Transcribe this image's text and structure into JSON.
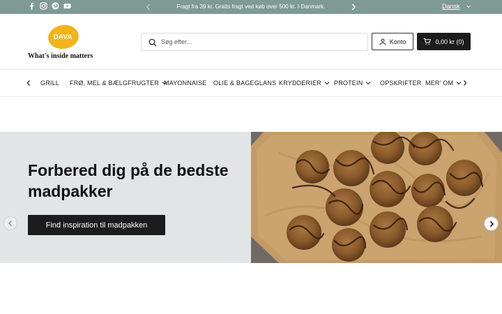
{
  "topbar": {
    "announcement": "Fragt fra 39 kr. Gratis fragt ved køb over 500 kr. I Danmark.",
    "language": "Dansk",
    "social_icons": [
      "facebook-icon",
      "instagram-icon",
      "pinterest-icon",
      "youtube-icon"
    ],
    "background_color": "#7f9a93"
  },
  "header": {
    "logo_word": "DAVA",
    "logo_tagline": "What's inside matters",
    "logo_color": "#f2b418",
    "search_placeholder": "Søg efter...",
    "account_label": "Konto",
    "cart_label": "0,00 kr (0)"
  },
  "nav": {
    "items": [
      {
        "label": "GRILL",
        "has_dropdown": false
      },
      {
        "label": "FRØ, MEL & BÆLGFRUGTER",
        "has_dropdown": true
      },
      {
        "label": "MAYONNAISE",
        "has_dropdown": false
      },
      {
        "label": "OLIE & BAGEGLANS",
        "has_dropdown": false
      },
      {
        "label": "KRYDDERIER",
        "has_dropdown": true
      },
      {
        "label": "PROTEIN",
        "has_dropdown": true
      },
      {
        "label": "OPSKRIFTER",
        "has_dropdown": false
      },
      {
        "label": "MER' OM",
        "has_dropdown": true
      }
    ]
  },
  "hero": {
    "title": "Forbered dig på de bedste madpakker",
    "cta_label": "Find inspiration til madpakken",
    "image": "chocolate-drizzled-oat-cookies-on-baking-paper",
    "background_color": "#e1e5e6"
  }
}
